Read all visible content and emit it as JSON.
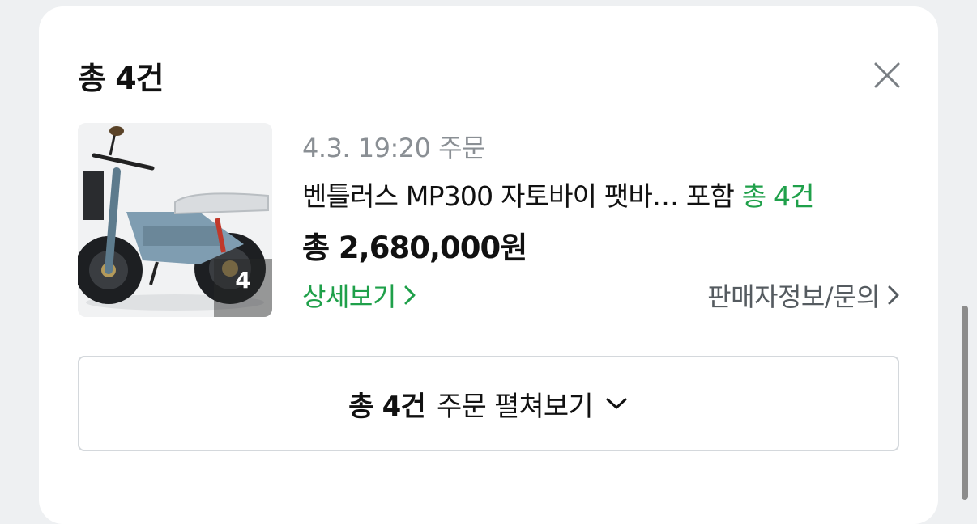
{
  "header": {
    "title": "총 4건"
  },
  "order": {
    "date_text": "4.3. 19:20 주문",
    "product_name": "벤틀러스 MP300 자토바이 팻바… 포함",
    "count_text": "총 4건",
    "total_price": "총 2,680,000원",
    "thumb_count": "4",
    "detail_label": "상세보기",
    "seller_label": "판매자정보/문의"
  },
  "expand_button": {
    "bold_label": "총 4건",
    "label": "주문 펼쳐보기"
  },
  "colors": {
    "accent_green": "#1fa04a",
    "muted_gray": "#8a8f94",
    "border_gray": "#d4d8dc"
  },
  "icons": {
    "close": "close-icon",
    "chevron_right": "chevron-right-icon",
    "chevron_down": "chevron-down-icon"
  }
}
